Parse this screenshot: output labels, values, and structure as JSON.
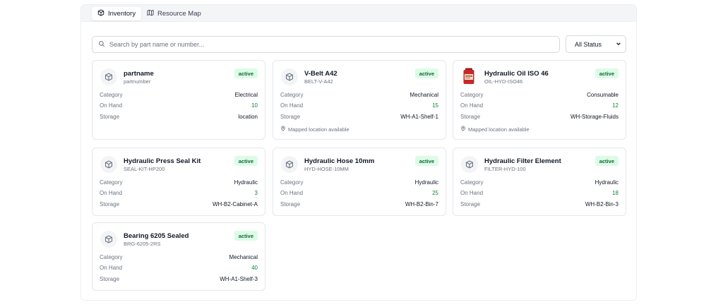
{
  "tabs": [
    {
      "label": "Inventory",
      "icon": "box-icon",
      "active": true
    },
    {
      "label": "Resource Map",
      "icon": "map-icon",
      "active": false
    }
  ],
  "search": {
    "placeholder": "Search by part name or number...",
    "value": ""
  },
  "status_filter": {
    "selected": "All Status"
  },
  "colors": {
    "accent_green": "#15803d",
    "badge_bg": "#dcfce7",
    "badge_text": "#166534"
  },
  "labels": {
    "category": "Category",
    "on_hand": "On Hand",
    "storage": "Storage"
  },
  "parts": [
    {
      "name": "partname",
      "number": "partnumber",
      "status": "active",
      "category": "Electrical",
      "on_hand": "10",
      "storage": "location",
      "mapped": "",
      "icon": "cube-icon"
    },
    {
      "name": "V-Belt A42",
      "number": "BELT-V-A42",
      "status": "active",
      "category": "Mechanical",
      "on_hand": "15",
      "storage": "WH-A1-Shelf-1",
      "mapped": "Mapped location available",
      "icon": "cube-icon"
    },
    {
      "name": "Hydraulic Oil ISO 46",
      "number": "OIL-HYD-ISO46",
      "status": "active",
      "category": "Consumable",
      "on_hand": "12",
      "storage": "WH-Storage-Fluids",
      "mapped": "Mapped location available",
      "icon": "oil-container-image"
    },
    {
      "name": "Hydraulic Press Seal Kit",
      "number": "SEAL-KIT-HP200",
      "status": "active",
      "category": "Hydraulic",
      "on_hand": "3",
      "storage": "WH-B2-Cabinet-A",
      "mapped": "",
      "icon": "cube-icon"
    },
    {
      "name": "Hydraulic Hose 10mm",
      "number": "HYD-HOSE-10MM",
      "status": "active",
      "category": "Hydraulic",
      "on_hand": "25",
      "storage": "WH-B2-Bin-7",
      "mapped": "",
      "icon": "cube-icon"
    },
    {
      "name": "Hydraulic Filter Element",
      "number": "FILTER-HYD-100",
      "status": "active",
      "category": "Hydraulic",
      "on_hand": "18",
      "storage": "WH-B2-Bin-3",
      "mapped": "",
      "icon": "cube-icon"
    },
    {
      "name": "Bearing 6205 Sealed",
      "number": "BRG-6205-2RS",
      "status": "active",
      "category": "Mechanical",
      "on_hand": "40",
      "storage": "WH-A1-Shelf-3",
      "mapped": "",
      "icon": "cube-icon"
    }
  ]
}
